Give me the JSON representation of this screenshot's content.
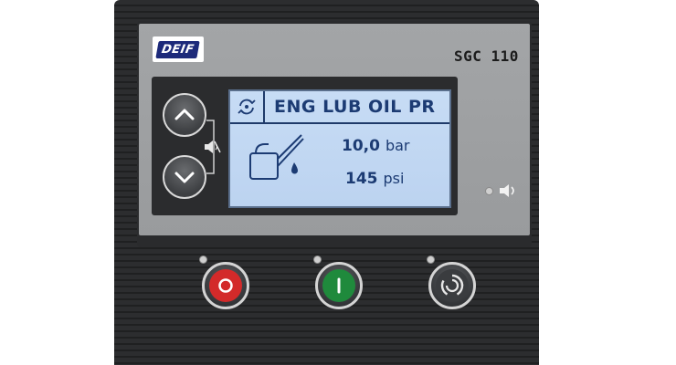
{
  "device": {
    "brand": "DEIF",
    "model": "SGC 110"
  },
  "display": {
    "title": "ENG LUB OIL PR",
    "readings": [
      {
        "value": "10,0",
        "unit": "bar"
      },
      {
        "value": "145",
        "unit": "psi"
      }
    ],
    "header_icon": "rotate-cycle-icon",
    "graphic_icon": "oil-can-icon"
  },
  "controls": {
    "nav": [
      {
        "icon": "chevron-up-icon"
      },
      {
        "icon": "chevron-down-icon"
      }
    ],
    "mute_icon": "speaker-mute-icon",
    "horn_icon": "speaker-icon",
    "buttons": [
      {
        "name": "stop",
        "icon": "stop-icon",
        "color": "#d32a2a"
      },
      {
        "name": "start",
        "icon": "start-icon",
        "color": "#1f8a3c"
      },
      {
        "name": "auto",
        "icon": "auto-mode-icon",
        "color": "#3a3c3f"
      }
    ]
  },
  "colors": {
    "lcd_text": "#1c3b73",
    "lcd_background": "#c7dcf5",
    "brand_blue": "#1d2a7a"
  }
}
